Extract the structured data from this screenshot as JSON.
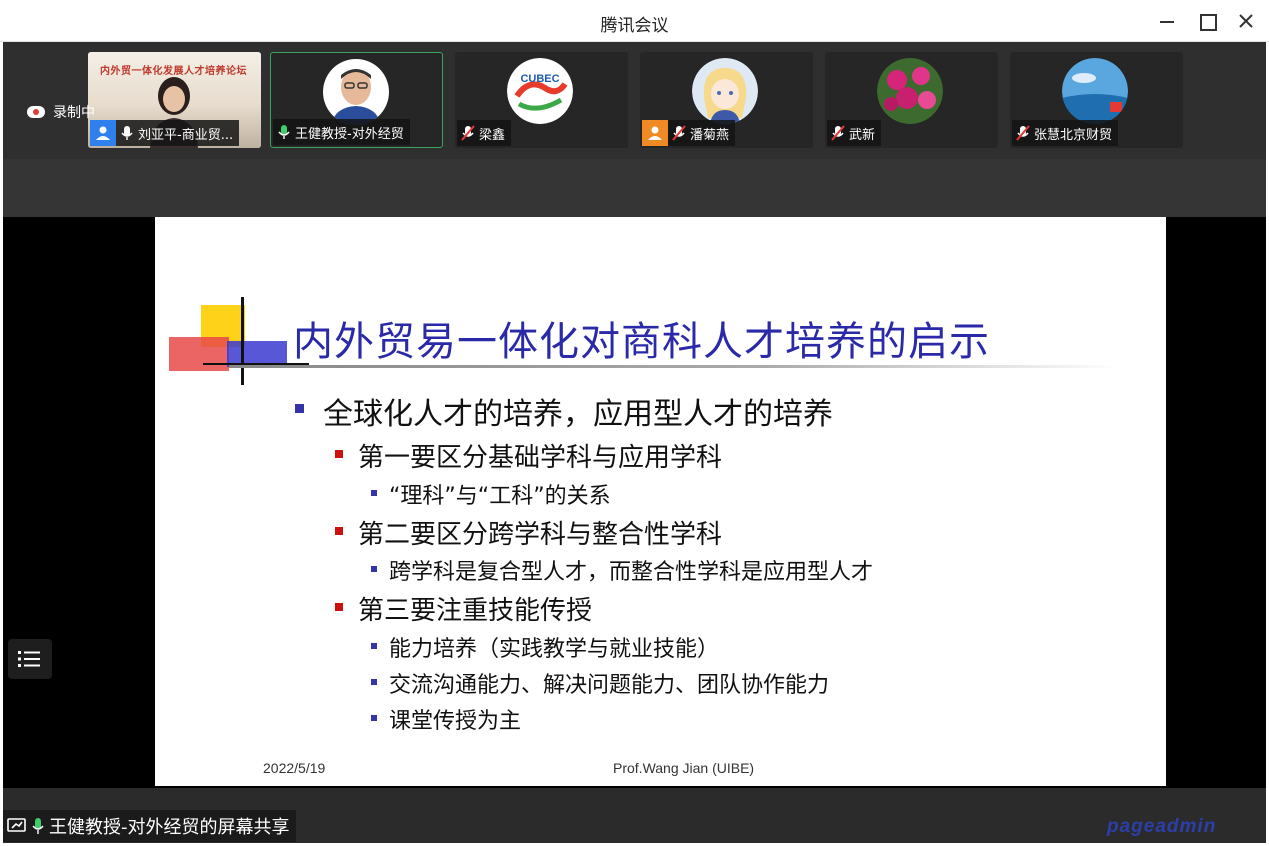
{
  "window": {
    "title": "腾讯会议"
  },
  "recording": {
    "label": "录制中"
  },
  "participants": [
    {
      "name": "刘亚平-商业贸...",
      "mic": "on",
      "badge": "user",
      "banner_text": "内外贸一体化发展人才培养论坛"
    },
    {
      "name": "王健教授-对外经贸",
      "mic": "on",
      "badge": "none"
    },
    {
      "name": "梁鑫",
      "mic": "muted",
      "badge": "none",
      "avatar_text": "CUBEC"
    },
    {
      "name": "潘菊燕",
      "mic": "muted",
      "badge": "user"
    },
    {
      "name": "武新",
      "mic": "muted",
      "badge": "none"
    },
    {
      "name": "张慧北京财贸",
      "mic": "muted",
      "badge": "none"
    }
  ],
  "slide": {
    "title": "内外贸易一体化对商科人才培养的启示",
    "l1": "全球化人才的培养，应用型人才的培养",
    "points": [
      {
        "text": "第一要区分基础学科与应用学科",
        "subs": [
          "“理科”与“工科”的关系"
        ]
      },
      {
        "text": "第二要区分跨学科与整合性学科",
        "subs": [
          "跨学科是复合型人才，而整合性学科是应用型人才"
        ]
      },
      {
        "text": "第三要注重技能传授",
        "subs": [
          "能力培养（实践教学与就业技能）",
          "交流沟通能力、解决问题能力、团队协作能力",
          "课堂传授为主"
        ]
      }
    ],
    "footer_date": "2022/5/19",
    "footer_author": "Prof.Wang Jian (UIBE)"
  },
  "share": {
    "label": "王健教授-对外经贸的屏幕共享"
  },
  "watermark": "pageadmin",
  "colors": {
    "title_blue": "#2a2aa8",
    "bullet_red": "#cc1111",
    "bullet_blue": "#3333aa",
    "active_green": "#3aa360"
  }
}
